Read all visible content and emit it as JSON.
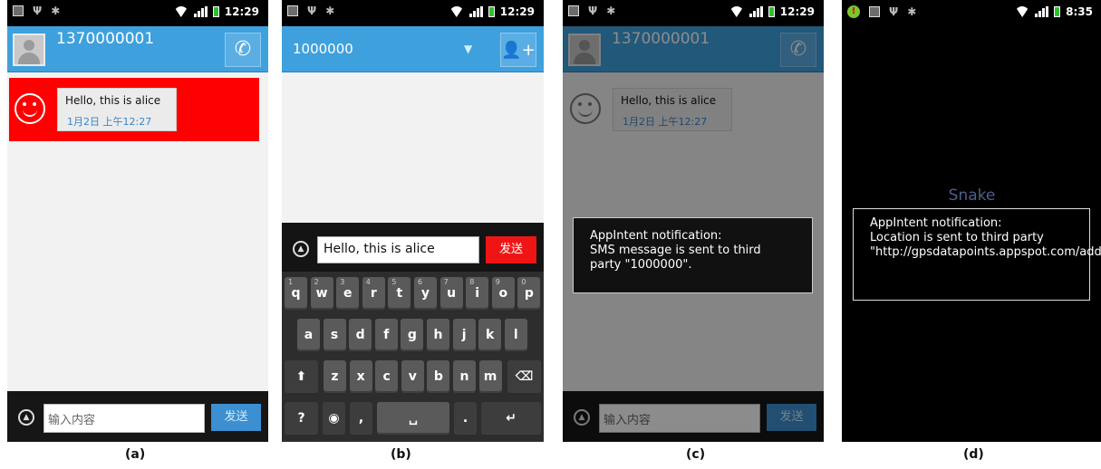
{
  "panels": {
    "a": {
      "caption": "(a)",
      "status_time": "12:29",
      "contact": "1370000001",
      "message": "Hello, this is alice",
      "message_time": "1月2日 上午12:27",
      "input_placeholder": "输入内容",
      "send_label": "发送",
      "highlight_color": "#ff0000"
    },
    "b": {
      "caption": "(b)",
      "status_time": "12:29",
      "recipient": "1000000",
      "input_value": "Hello, this is alice",
      "send_label": "发送",
      "keyboard": {
        "row1": [
          "q",
          "w",
          "e",
          "r",
          "t",
          "y",
          "u",
          "i",
          "o",
          "p"
        ],
        "row1_nums": [
          "1",
          "2",
          "3",
          "4",
          "5",
          "6",
          "7",
          "8",
          "9",
          "0"
        ],
        "row2": [
          "a",
          "s",
          "d",
          "f",
          "g",
          "h",
          "j",
          "k",
          "l"
        ],
        "row3": [
          "z",
          "x",
          "c",
          "v",
          "b",
          "n",
          "m"
        ],
        "sym_label": "?123",
        "comma": ",",
        "period": "."
      }
    },
    "c": {
      "caption": "(c)",
      "status_time": "12:29",
      "contact": "1370000001",
      "message": "Hello, this is alice",
      "message_time": "1月2日 上午12:27",
      "input_placeholder": "输入内容",
      "send_label": "发送",
      "notification": "AppIntent notification:\nSMS message is sent to third party \"1000000\"."
    },
    "d": {
      "caption": "(d)",
      "status_time": "8:35",
      "app_title": "Snake",
      "notification": "AppIntent notification:\nLocation is sent to third party \"http://gpsdatapoints.appspot.com/addPoint\"."
    }
  },
  "colors": {
    "blue_bar": "#3ea1dd",
    "send_red": "#ef1515",
    "send_blue": "#3c8fd0"
  }
}
